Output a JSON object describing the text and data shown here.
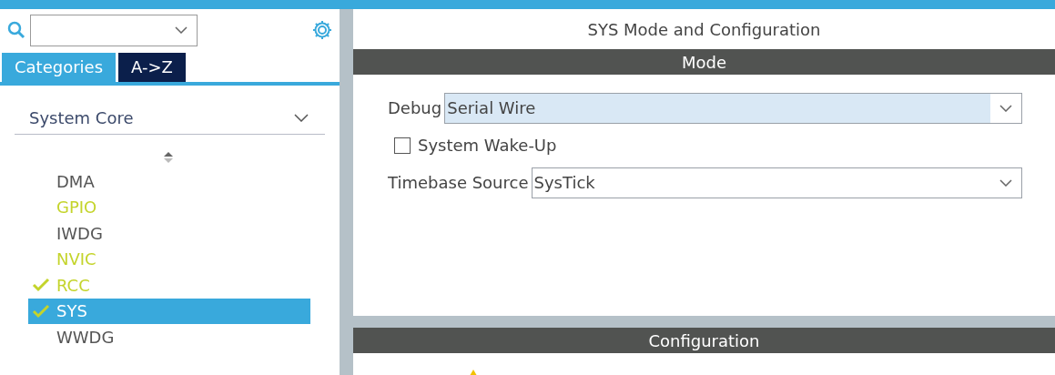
{
  "sidebar": {
    "tabs": [
      {
        "label": "Categories",
        "selected": true
      },
      {
        "label": "A->Z",
        "selected": false
      }
    ],
    "category": {
      "label": "System Core",
      "expanded": true
    },
    "items": [
      {
        "label": "DMA",
        "color": "#555555",
        "checked": false,
        "selected": false
      },
      {
        "label": "GPIO",
        "color": "#c4d42b",
        "checked": false,
        "selected": false
      },
      {
        "label": "IWDG",
        "color": "#555555",
        "checked": false,
        "selected": false
      },
      {
        "label": "NVIC",
        "color": "#c4d42b",
        "checked": false,
        "selected": false
      },
      {
        "label": "RCC",
        "color": "#c4d42b",
        "checked": true,
        "selected": false
      },
      {
        "label": "SYS",
        "color": "#c4d42b",
        "checked": true,
        "selected": true
      },
      {
        "label": "WWDG",
        "color": "#555555",
        "checked": false,
        "selected": false
      }
    ]
  },
  "main": {
    "title": "SYS Mode and Configuration",
    "mode_header": "Mode",
    "fields": [
      {
        "kind": "select",
        "label": "Debug",
        "value": "Serial Wire",
        "highlighted": true
      },
      {
        "kind": "checkbox",
        "label": "System Wake-Up",
        "checked": false
      },
      {
        "kind": "select",
        "label": "Timebase Source",
        "value": "SysTick",
        "highlighted": false
      }
    ],
    "config_header": "Configuration"
  }
}
